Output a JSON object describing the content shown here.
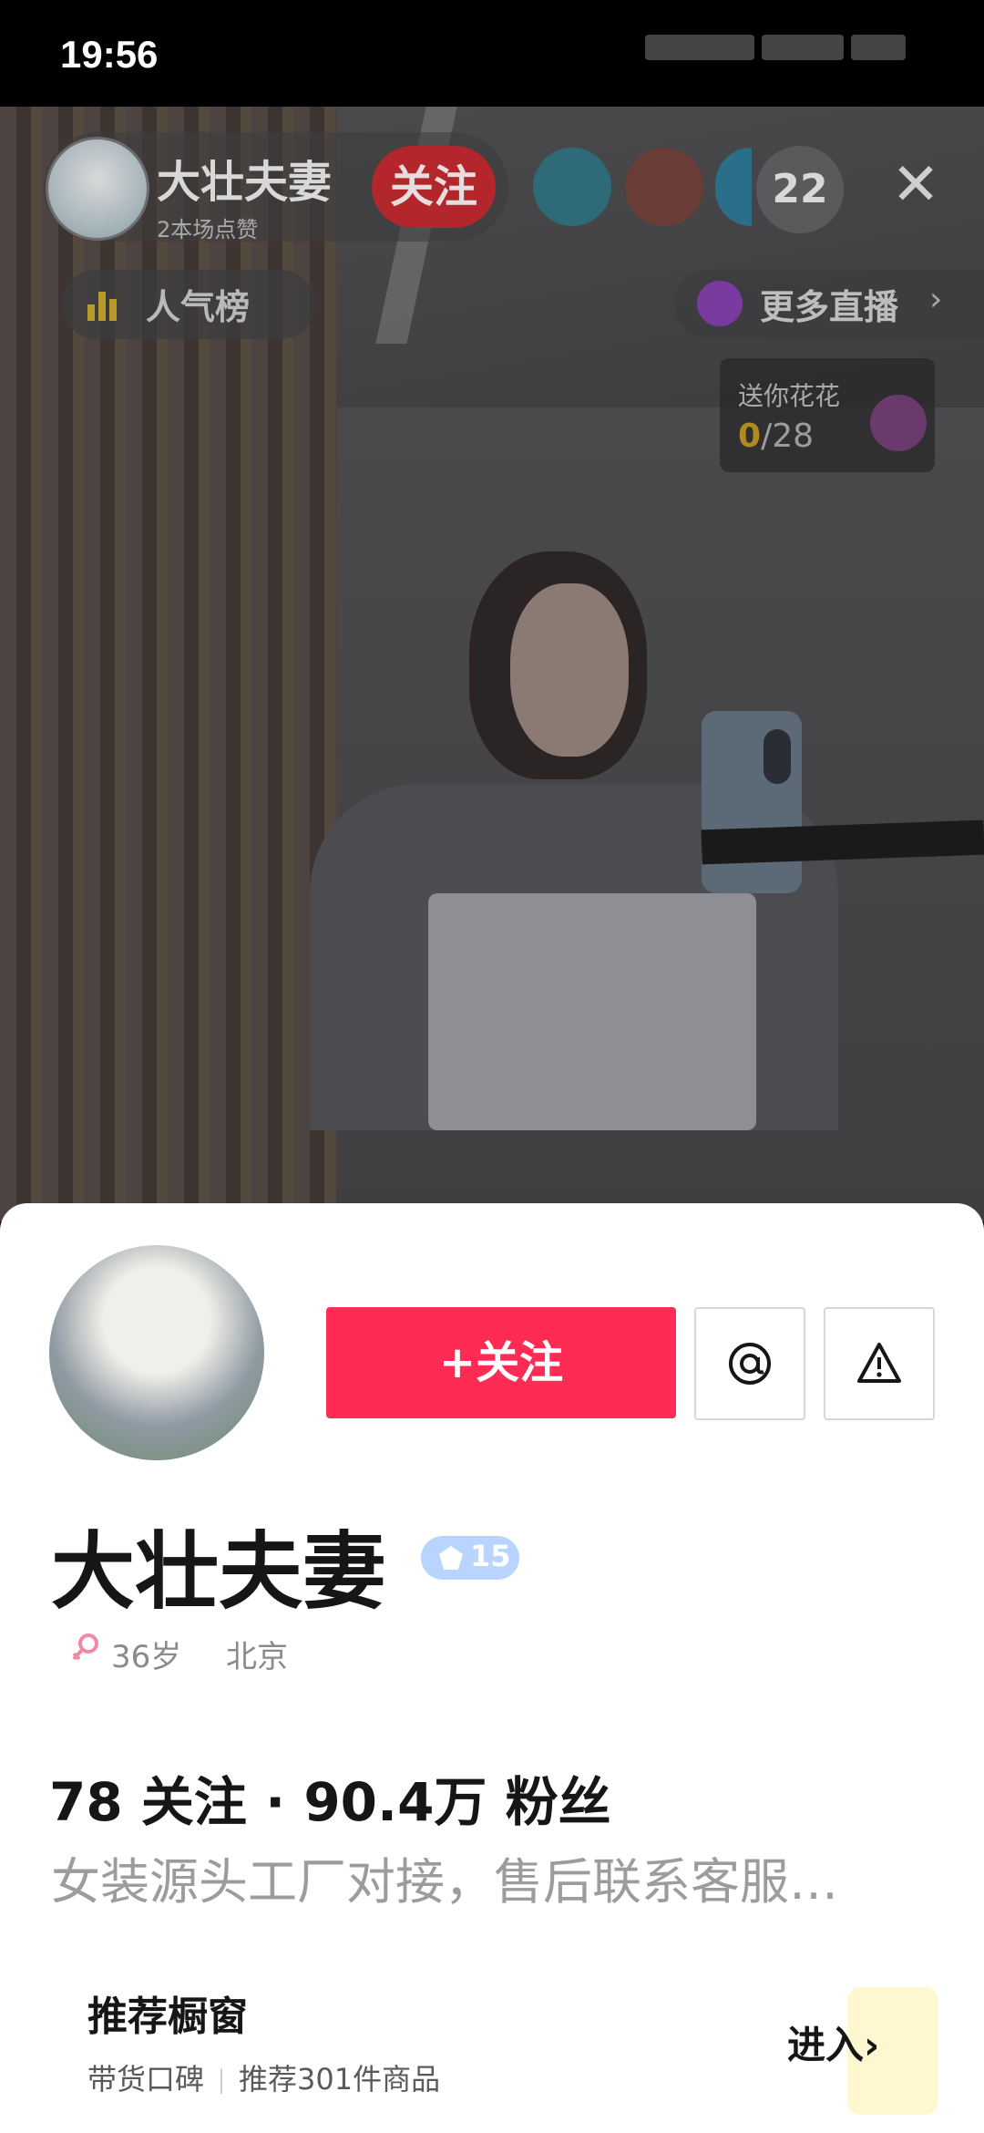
{
  "status_bar": {
    "time": "19:56"
  },
  "live": {
    "anchor": {
      "name": "大壮夫妻",
      "likes": "2本场点赞",
      "follow_label": "关注"
    },
    "viewer_count": "22",
    "close_icon": "close-icon",
    "popularity_label": "人气榜",
    "more_live_label": "更多直播",
    "gift_task": {
      "title": "送你花花",
      "current": "0",
      "total": "/28"
    }
  },
  "profile": {
    "follow_button": "+关注",
    "mention_icon": "at-icon",
    "report_icon": "warning-icon",
    "name": "大壮夫妻",
    "level": "15",
    "age": "36岁",
    "location": "北京",
    "stats": "78 关注 · 90.4万 粉丝",
    "bio": "女装源头工厂对接，售后联系客服…",
    "shop_window": {
      "title": "推荐橱窗",
      "reputation": "带货口碑",
      "items": "推荐301件商品",
      "enter": "进入"
    }
  },
  "colors": {
    "accent": "#fe2c55",
    "live_follow": "#b3262c",
    "level_badge": "#b8d4ff"
  }
}
